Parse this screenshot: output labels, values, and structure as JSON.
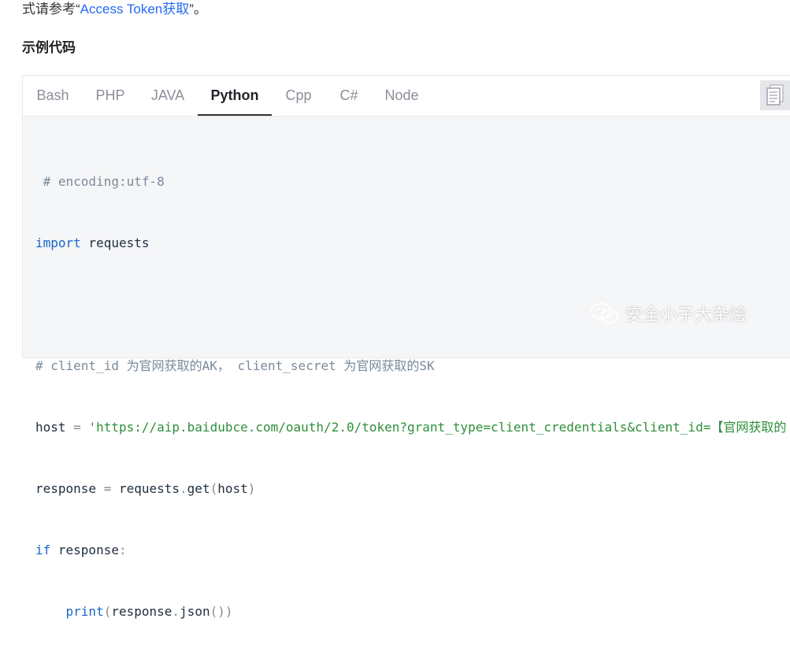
{
  "intro": {
    "prefix": "式请参考“",
    "link": "Access Token获取",
    "suffix": "”。"
  },
  "section_title": "示例代码",
  "tabs": [
    {
      "label": "Bash",
      "active": false
    },
    {
      "label": "PHP",
      "active": false
    },
    {
      "label": "JAVA",
      "active": false
    },
    {
      "label": "Python",
      "active": true
    },
    {
      "label": "Cpp",
      "active": false
    },
    {
      "label": "C#",
      "active": false
    },
    {
      "label": "Node",
      "active": false
    }
  ],
  "copy_icon": "copy-icon",
  "code": {
    "l1": " # encoding:utf-8",
    "l2_kw": "import",
    "l2_rest": " requests",
    "l4": "# client_id 为官网获取的AK， client_secret 为官网获取的SK",
    "l5_var": "host",
    "l5_eq": " = ",
    "l5_str": "'https://aip.baidubce.com/oauth/2.0/token?grant_type=client_credentials&client_id=【官网获取的",
    "l6_var": "response",
    "l6_eq": " = ",
    "l6_obj": "requests",
    "l6_dot": ".",
    "l6_fn": "get",
    "l6_p1": "(",
    "l6_arg": "host",
    "l6_p2": ")",
    "l7_kw": "if",
    "l7_rest": " response",
    "l7_colon": ":",
    "l8_indent": "    ",
    "l8_fn": "print",
    "l8_p1": "(",
    "l8_obj": "response",
    "l8_dot": ".",
    "l8_method": "json",
    "l8_p2": "())"
  },
  "watermark": {
    "text": "安全小子大杂烩",
    "icon": "wechat-icon"
  },
  "colors": {
    "link": "#2468f2",
    "keyword": "#1a66c9",
    "string": "#2f8f3a",
    "comment": "#7a8a99"
  }
}
